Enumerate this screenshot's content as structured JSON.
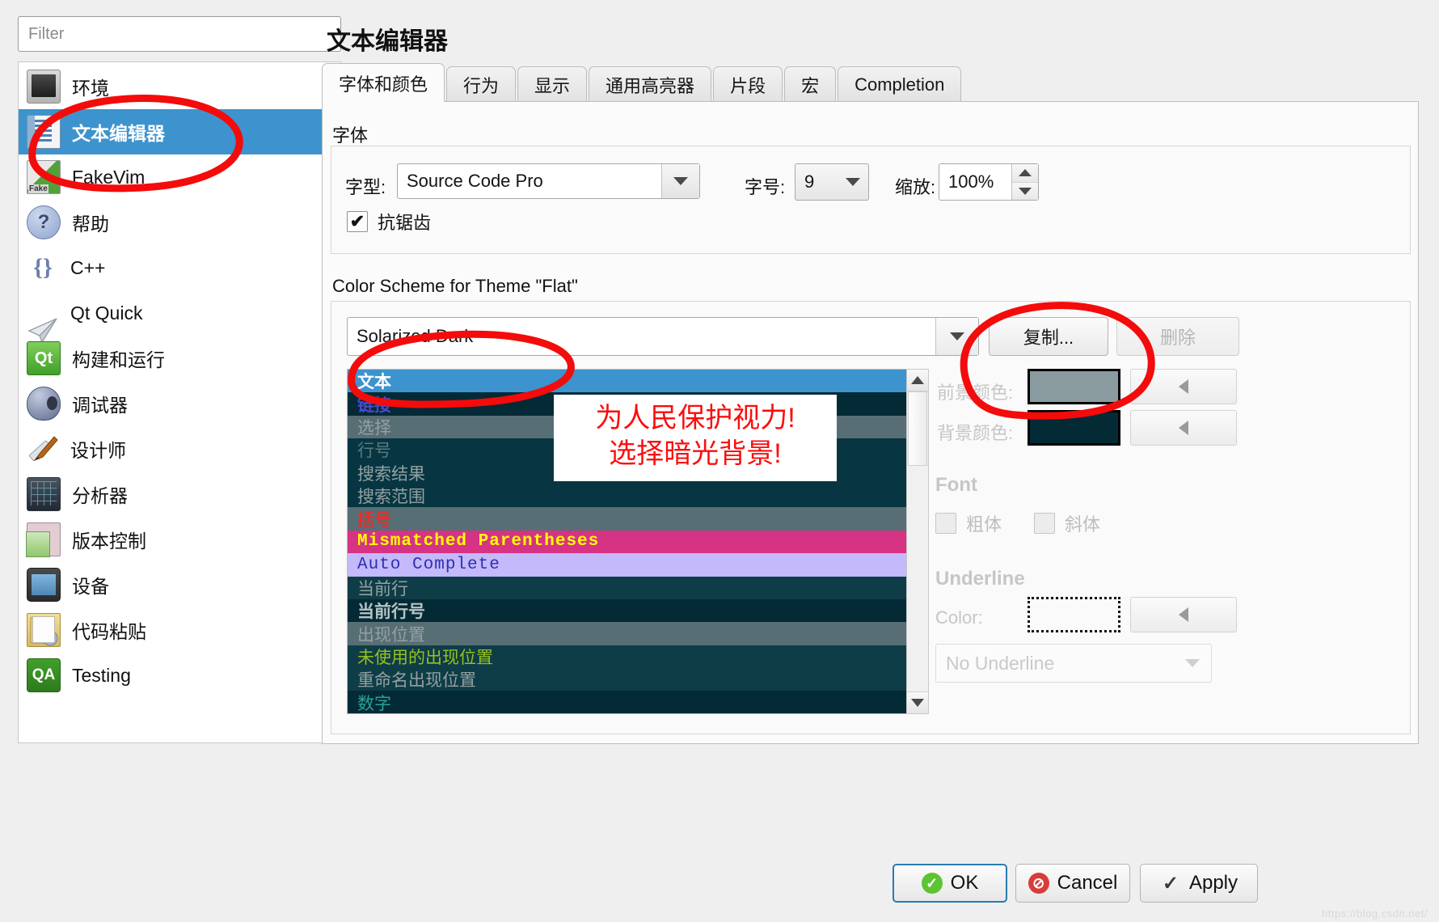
{
  "sidebar": {
    "filter_placeholder": "Filter",
    "items": [
      {
        "label": "环境",
        "icon": "monitor-icon",
        "selected": false
      },
      {
        "label": "文本编辑器",
        "icon": "text-editor-icon",
        "selected": true
      },
      {
        "label": "FakeVim",
        "icon": "fakevim-icon",
        "selected": false
      },
      {
        "label": "帮助",
        "icon": "help-icon",
        "selected": false
      },
      {
        "label": "C++",
        "icon": "braces-icon",
        "selected": false
      },
      {
        "label": "Qt Quick",
        "icon": "paper-plane-icon",
        "selected": false
      },
      {
        "label": "构建和运行",
        "icon": "qt-build-icon",
        "selected": false
      },
      {
        "label": "调试器",
        "icon": "bug-icon",
        "selected": false
      },
      {
        "label": "设计师",
        "icon": "designer-icon",
        "selected": false
      },
      {
        "label": "分析器",
        "icon": "analyzer-icon",
        "selected": false
      },
      {
        "label": "版本控制",
        "icon": "version-control-icon",
        "selected": false
      },
      {
        "label": "设备",
        "icon": "device-icon",
        "selected": false
      },
      {
        "label": "代码粘贴",
        "icon": "code-paste-icon",
        "selected": false
      },
      {
        "label": "Testing",
        "icon": "qa-icon",
        "selected": false
      }
    ]
  },
  "header": {
    "title": "文本编辑器"
  },
  "tabs": [
    {
      "label": "字体和颜色",
      "active": true
    },
    {
      "label": "行为",
      "active": false
    },
    {
      "label": "显示",
      "active": false
    },
    {
      "label": "通用高亮器",
      "active": false
    },
    {
      "label": "片段",
      "active": false
    },
    {
      "label": "宏",
      "active": false
    },
    {
      "label": "Completion",
      "active": false
    }
  ],
  "font_section": {
    "heading": "字体",
    "family_label": "字型:",
    "family_value": "Source Code Pro",
    "size_label": "字号:",
    "size_value": "9",
    "zoom_label": "缩放:",
    "zoom_value": "100%",
    "antialias_label": "抗锯齿",
    "antialias_checked": true
  },
  "scheme_section": {
    "heading": "Color Scheme for Theme \"Flat\"",
    "selected_scheme": "Solarized Dark",
    "copy_button": "复制...",
    "delete_button": "删除",
    "delete_enabled": false
  },
  "scheme_list": [
    {
      "label": "文本",
      "fg": "#ffffff",
      "bg": "#3d93cd",
      "bold": true,
      "mono": false
    },
    {
      "label": "链接",
      "fg": "#4a4acb",
      "bg": "#042a36",
      "bold": true,
      "mono": false
    },
    {
      "label": "选择",
      "fg": "#93a1a1",
      "bg": "#586e75",
      "bold": false,
      "mono": false
    },
    {
      "label": "行号",
      "fg": "#5a7a80",
      "bg": "#073642",
      "bold": false,
      "mono": false
    },
    {
      "label": "搜索结果",
      "fg": "#93a1a1",
      "bg": "#073642",
      "bold": false,
      "mono": false
    },
    {
      "label": "搜索范围",
      "fg": "#93a1a1",
      "bg": "#073642",
      "bold": false,
      "mono": false
    },
    {
      "label": "括号",
      "fg": "#dc322f",
      "bg": "#586e75",
      "bold": true,
      "mono": false
    },
    {
      "label": "Mismatched Parentheses",
      "fg": "#ffff00",
      "bg": "#d63384",
      "bold": true,
      "mono": true
    },
    {
      "label": "Auto Complete",
      "fg": "#2f2fb0",
      "bg": "#c3b9fb",
      "bold": false,
      "mono": true
    },
    {
      "label": "当前行",
      "fg": "#93a1a1",
      "bg": "#0f3d47",
      "bold": false,
      "mono": false
    },
    {
      "label": "当前行号",
      "fg": "#b5c4c4",
      "bg": "#042a36",
      "bold": true,
      "mono": false
    },
    {
      "label": "出现位置",
      "fg": "#93a1a1",
      "bg": "#586e75",
      "bold": false,
      "mono": false
    },
    {
      "label": "未使用的出现位置",
      "fg": "#95c11f",
      "bg": "#0f3d47",
      "bold": false,
      "mono": false
    },
    {
      "label": "重命名出现位置",
      "fg": "#93a1a1",
      "bg": "#0f3d47",
      "bold": false,
      "mono": false
    },
    {
      "label": "数字",
      "fg": "#2aa198",
      "bg": "#042a36",
      "bold": false,
      "mono": false
    }
  ],
  "detail_panel": {
    "foreground_label": "前景颜色:",
    "foreground_color": "#8a9ba0",
    "background_label": "背景颜色:",
    "background_color": "#042a36",
    "font_heading": "Font",
    "bold_label": "粗体",
    "bold_checked": false,
    "italic_label": "斜体",
    "italic_checked": false,
    "underline_heading": "Underline",
    "underline_color_label": "Color:",
    "underline_style_value": "No Underline"
  },
  "annotation": {
    "line1": "为人民保护视力!",
    "line2": "选择暗光背景!",
    "color": "#fb0d0d"
  },
  "dialog_buttons": {
    "ok": "OK",
    "cancel": "Cancel",
    "apply": "Apply"
  },
  "watermark": "https://blog.csdn.net/"
}
